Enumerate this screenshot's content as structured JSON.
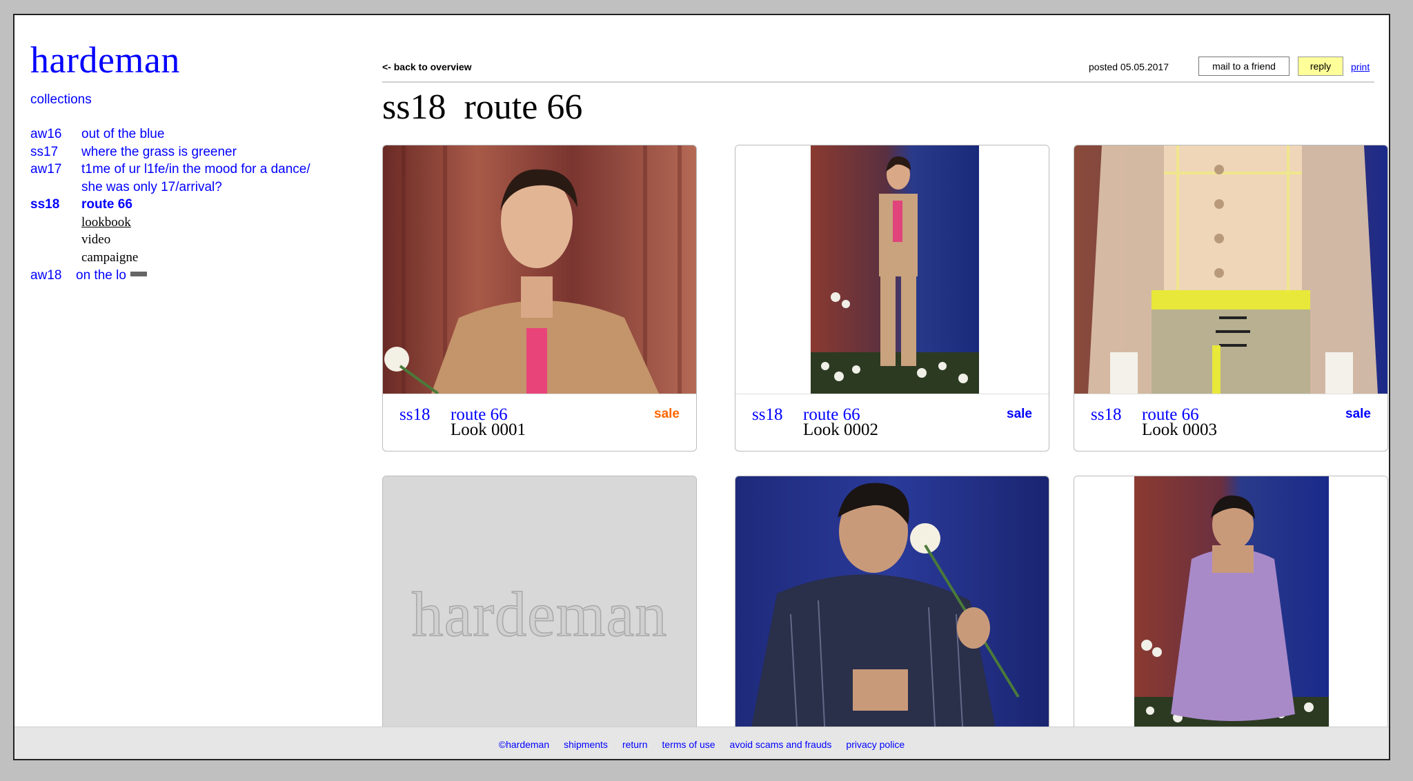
{
  "brand": "hardeman",
  "nav": {
    "collections_label": "collections",
    "items": [
      {
        "season": "aw16",
        "title": "out of the blue"
      },
      {
        "season": "ss17",
        "title": "where the grass is greener"
      },
      {
        "season": "aw17",
        "title": "t1me of ur l1fe/in the mood for a dance/",
        "title2": "she was only 17/arrival?"
      },
      {
        "season": "ss18",
        "title": "route 66",
        "sub": [
          "lookbook",
          "video",
          "campaigne"
        ]
      },
      {
        "season": "aw18",
        "title": "on the lo"
      }
    ]
  },
  "header": {
    "back": "<- back to overview",
    "posted": "posted 05.05.2017",
    "mail": "mail to a friend",
    "reply": "reply",
    "print": "print",
    "title": "ss18  route 66"
  },
  "cards": [
    {
      "season": "ss18",
      "collection": "route 66",
      "look": "Look 0001",
      "sale": "sale",
      "sale_color": "#ff6600"
    },
    {
      "season": "ss18",
      "collection": "route 66",
      "look": "Look 0002",
      "sale": "sale",
      "sale_color": "#0000ff"
    },
    {
      "season": "ss18",
      "collection": "route 66",
      "look": "Look 0003",
      "sale": "sale",
      "sale_color": "#0000ff"
    }
  ],
  "placeholder": "hardeman",
  "footer": [
    "©hardeman",
    "shipments",
    "return",
    "terms of use",
    "avoid scams and frauds",
    "privacy police"
  ],
  "colors": {
    "link": "#0000ff",
    "reply_bg": "#ffff99",
    "footer_bg": "#e6e6e6"
  }
}
